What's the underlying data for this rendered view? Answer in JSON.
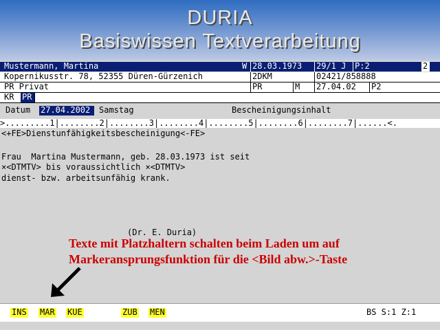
{
  "banner": {
    "title": "DURIA",
    "subtitle": "Basiswissen Textverarbeitung"
  },
  "patient": {
    "name": "Mustermann, Martina",
    "sex": "W",
    "dob": "28.03.1973",
    "id": "29/1 J",
    "p": "P:2",
    "num": "2",
    "street": "Kopernikusstr. 78, 52355 Düren-Gürzenich",
    "code": "2DKM",
    "phone": "02421/858888",
    "insurance": "PR Privat",
    "ins_short": "PR",
    "m": "M",
    "date": "27.04.02",
    "p2": "P2",
    "kr": "KR",
    "pr": "PR"
  },
  "doc": {
    "datum_label": "Datum",
    "datum": "27.04.2002",
    "weekday": "Samstag",
    "section": "Bescheinigungsinhalt",
    "ruler": ">.........1|........2|........3|........4|........5|........6|........7|......<.",
    "header_line": "<+FE>Dienstunfähigkeitsbescheinigung<-FE>",
    "line1": "Frau  Martina Mustermann, geb. 28.03.1973 ist seit",
    "line2": "×<DTMTV> bis voraussichtlich ×<DTMTV>",
    "line3": "dienst- bzw. arbeitsunfähig krank.",
    "signature": "(Dr. E. Duria)"
  },
  "annotation": {
    "line1": "Texte mit Platzhaltern schalten beim Laden um auf",
    "line2": "Markeranspr­ungsfunktion für die <Bild abw.>-Taste"
  },
  "statusbar": {
    "keys": [
      "INS",
      "MAR",
      "KUE",
      "ZUB",
      "MEN"
    ],
    "right": "BS S:1 Z:1"
  }
}
